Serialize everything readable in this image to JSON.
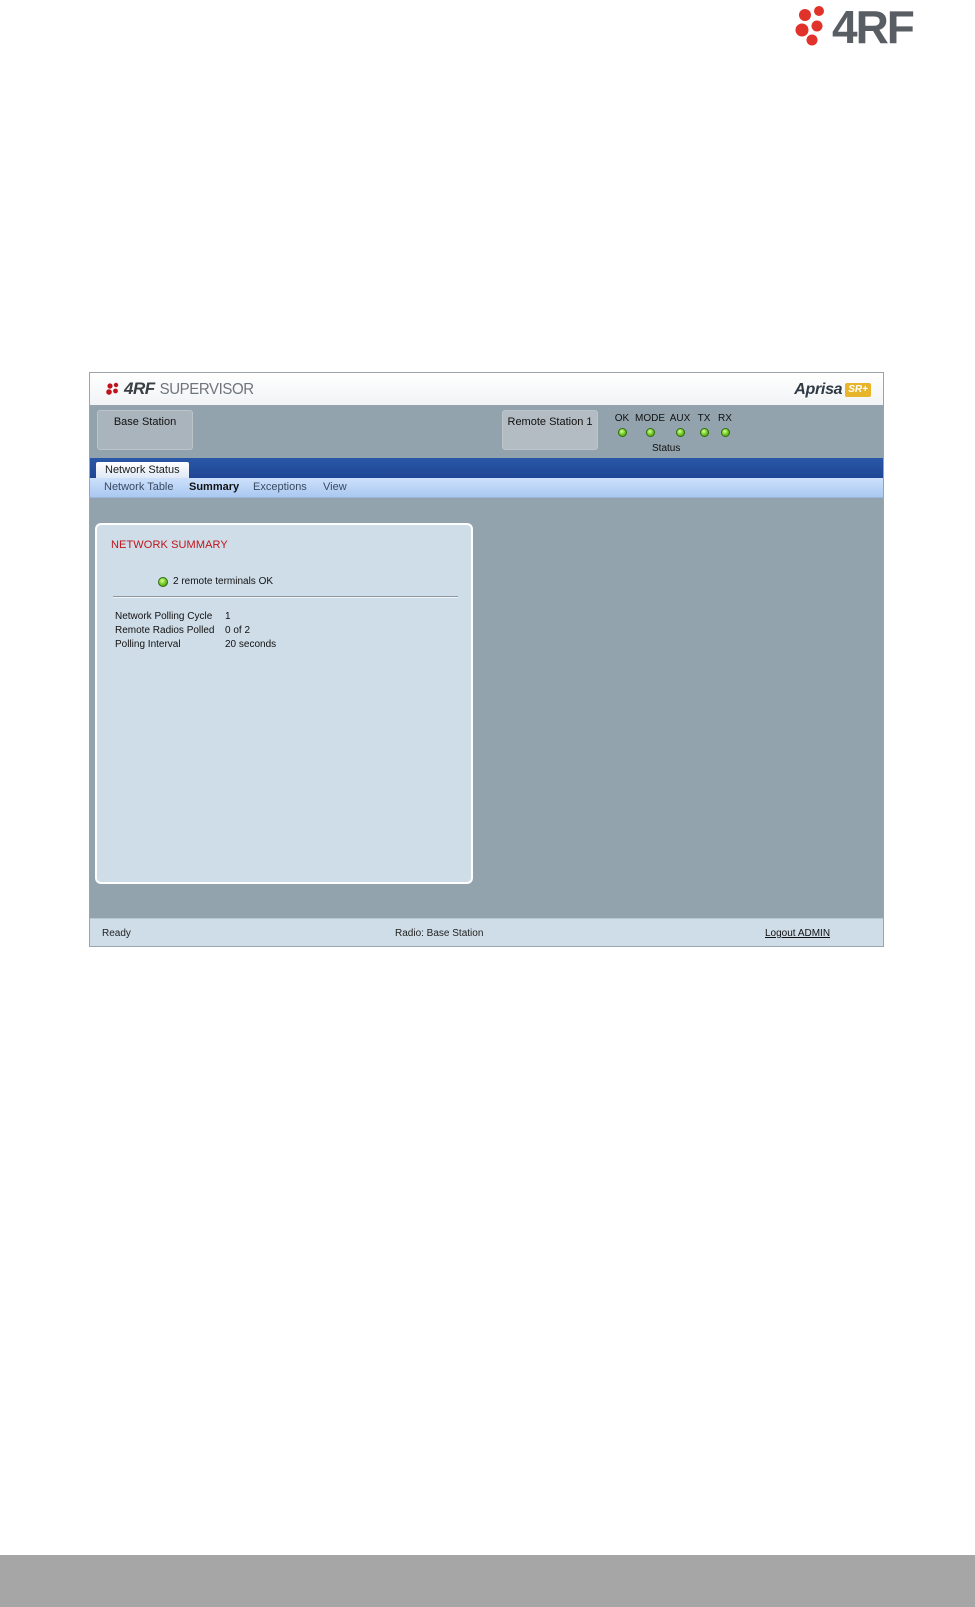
{
  "page": {
    "logo_text": "4RF",
    "colors": {
      "logo_red": "#e0312a",
      "logo_gray": "#585e63",
      "bottom_band": "#a6a6a6"
    }
  },
  "app": {
    "brand": {
      "name": "4RF",
      "product": "SUPERVISOR",
      "icon": "4rf-dots-icon"
    },
    "aprisa": {
      "name": "Aprisa",
      "badge": "SR+"
    },
    "stations": [
      {
        "label": "Base Station"
      },
      {
        "label": "Remote Station 1"
      }
    ],
    "leds": [
      {
        "label": "OK",
        "state": "green"
      },
      {
        "label": "MODE",
        "state": "green"
      },
      {
        "label": "AUX",
        "state": "green"
      },
      {
        "label": "TX",
        "state": "green"
      },
      {
        "label": "RX",
        "state": "green"
      }
    ],
    "status_label": "Status",
    "tabs": [
      {
        "label": "Network Status",
        "active": true
      }
    ],
    "subnav": [
      {
        "label": "Network Table",
        "active": false
      },
      {
        "label": "Summary",
        "active": true
      },
      {
        "label": "Exceptions",
        "active": false
      },
      {
        "label": "View",
        "active": false
      }
    ],
    "panel": {
      "title": "NETWORK SUMMARY",
      "summary": "2 remote terminals OK",
      "rows": [
        {
          "key": "Network Polling Cycle",
          "value": "1"
        },
        {
          "key": "Remote Radios Polled",
          "value": "0 of 2"
        },
        {
          "key": "Polling Interval",
          "value": "20 seconds"
        }
      ]
    },
    "footer": {
      "status": "Ready",
      "radio": "Radio: Base Station",
      "logout": "Logout ADMIN"
    },
    "colors": {
      "background": "#93a3ad",
      "tabbar": "#2450a0",
      "subnav": "#bcd4f6",
      "panel": "#cfdde8",
      "title_red": "#c0141c",
      "led_green": "#7bd12a"
    }
  }
}
